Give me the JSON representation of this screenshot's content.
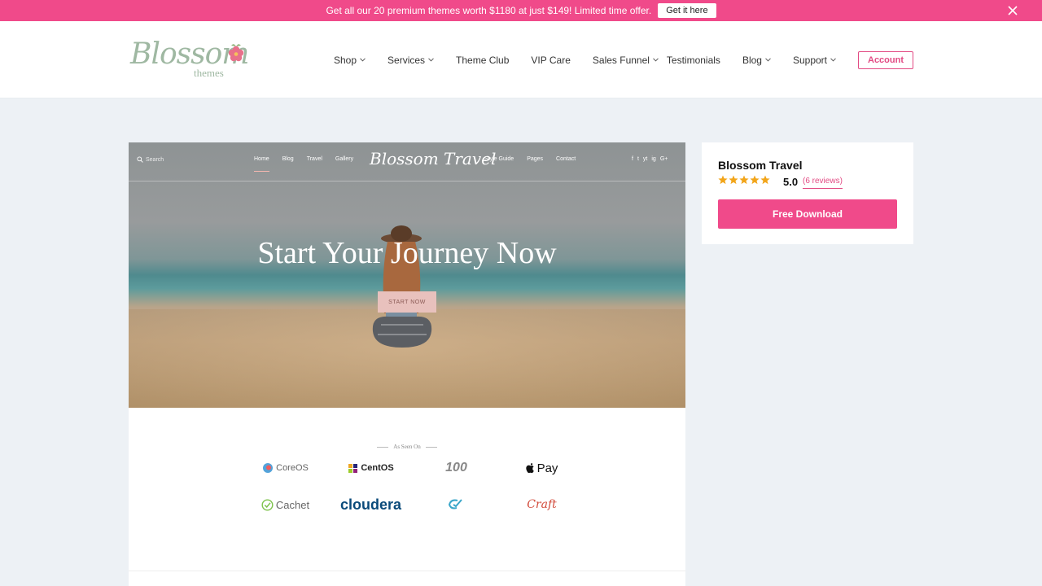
{
  "promo": {
    "text": "Get all our 20 premium themes worth $1180 at just $149! Limited time offer.",
    "button": "Get it here"
  },
  "header": {
    "logo_script": "Blossom",
    "logo_sub": "themes",
    "nav_left": [
      "Shop",
      "Services",
      "Theme Club",
      "VIP Care",
      "Sales Funnel"
    ],
    "nav_right": [
      "Testimonials",
      "Blog",
      "Support"
    ],
    "account": "Account"
  },
  "preview": {
    "search": "Search",
    "menu_left": [
      "Home",
      "Blog",
      "Travel",
      "Gallery"
    ],
    "brand": "Blossom Travel",
    "menu_right": [
      "Style Guide",
      "Pages",
      "Contact"
    ],
    "social": [
      "f",
      "t",
      "yt",
      "ig",
      "G+"
    ],
    "hero_title": "Start Your Journey Now",
    "hero_button": "START NOW",
    "seen_on": "As Seen On",
    "brands": [
      "CoreOS",
      "CentOS",
      "100",
      "Pay",
      "Cachet",
      "cloudera",
      "",
      "Craft"
    ]
  },
  "card": {
    "title": "Blossom Travel",
    "rating": "5.0",
    "stars": 5,
    "reviews": "(6 reviews)",
    "download": "Free Download"
  },
  "colors": {
    "accent": "#f04a8a",
    "star": "#f2a51a",
    "background": "#edf1f5"
  }
}
